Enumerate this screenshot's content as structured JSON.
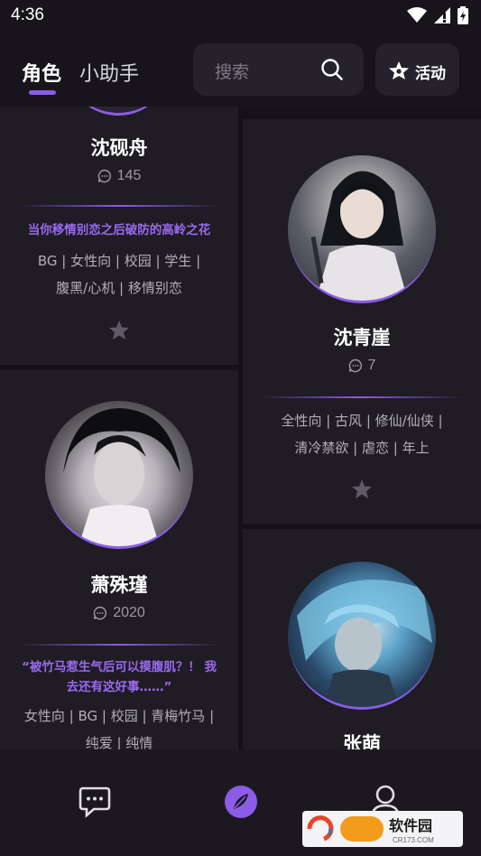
{
  "status_bar": {
    "time": "4:36"
  },
  "header": {
    "tabs": [
      {
        "label": "角色"
      },
      {
        "label": "小助手"
      }
    ],
    "search": {
      "placeholder": "搜索"
    },
    "activity": {
      "label": "活动"
    }
  },
  "cards": [
    {
      "name": "沈砚舟",
      "count": "145",
      "quote": "当你移情别恋之后破防的高岭之花",
      "tags_line1": "BG | 女性向 | 校园 | 学生 |",
      "tags_line2": "腹黑/心机 | 移情别恋"
    },
    {
      "name": "沈青崖",
      "count": "7",
      "tags_line1": "全性向 | 古风 | 修仙/仙侠 |",
      "tags_line2": "清冷禁欲 | 虐恋 | 年上"
    },
    {
      "name": "萧殊瑾",
      "count": "2020",
      "quote_line1": "“被竹马惹生气后可以摸腹肌？！ 我",
      "quote_line2": "去还有这好事……”",
      "tags_line1": "女性向 | BG | 校园 | 青梅竹马 |",
      "tags_line2": "纯爱 | 纯情"
    },
    {
      "name": "张萌"
    }
  ],
  "bottom_nav": {
    "items": [
      {
        "icon": "chat-icon"
      },
      {
        "icon": "compass-icon"
      },
      {
        "icon": "profile-icon"
      }
    ]
  },
  "watermark": {
    "text": "软件园",
    "subtext": "CR173.COM"
  },
  "colors": {
    "accent": "#8c5ce8",
    "background": "#141218",
    "card": "#1f1c24"
  }
}
